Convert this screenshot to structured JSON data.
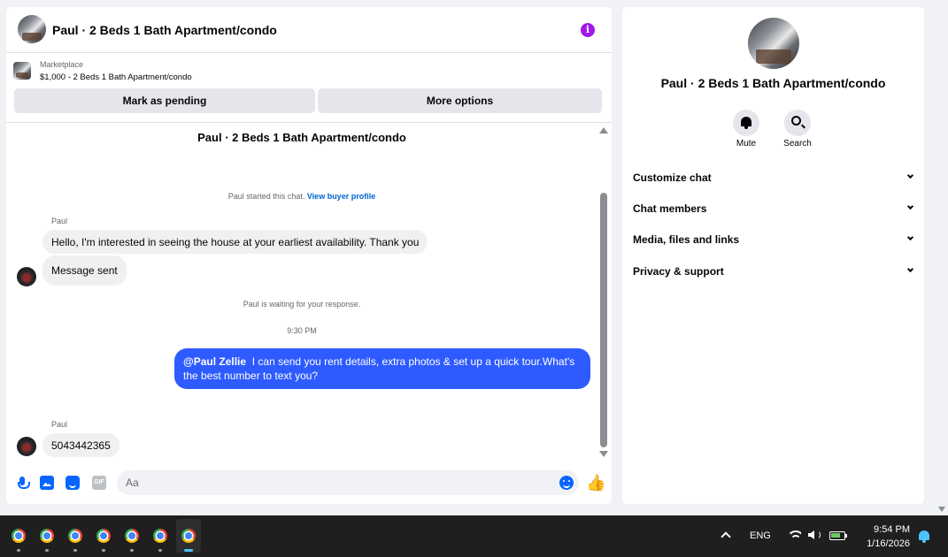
{
  "chat": {
    "header_title": "Paul · 2 Beds 1 Bath Apartment/condo",
    "info_glyph": "i",
    "marketplace_label": "Marketplace",
    "listing": "$1,000 - 2 Beds 1 Bath Apartment/condo",
    "mark_pending_label": "Mark as pending",
    "more_options_label": "More options",
    "thread_title": "Paul · 2 Beds 1 Bath Apartment/condo",
    "started_text": "Paul started this chat.",
    "view_profile_link": "View buyer profile",
    "waiting_text": "Paul is waiting for your response.",
    "timestamp": "9:30 PM",
    "messages": [
      {
        "sender": "Paul",
        "text": "Hello, I'm interested in seeing the house at your earliest availability. Thank you"
      },
      {
        "text": "Message sent"
      },
      {
        "mention": "@Paul Zellie",
        "text": "I can send you rent details, extra photos & set up a quick tour.What's the best number to text you?"
      },
      {
        "sender": "Paul",
        "text": "5043442365"
      }
    ],
    "composer_placeholder": "Aa",
    "gif_label": "GIF",
    "like_glyph": "👍"
  },
  "side": {
    "title": "Paul · 2 Beds 1 Bath Apartment/condo",
    "mute_label": "Mute",
    "search_label": "Search",
    "sections": [
      "Customize chat",
      "Chat members",
      "Media, files and links",
      "Privacy & support"
    ]
  },
  "taskbar": {
    "apps": [
      "chrome-icon",
      "chrome-icon",
      "chrome-icon",
      "chrome-icon",
      "chrome-icon",
      "chrome-icon",
      "chrome-icon"
    ],
    "language": "ENG",
    "time": "9:54 PM",
    "date": "1/16/2026"
  },
  "colors": {
    "outgoing_bubble": "#2e5bff",
    "accent": "#0866ff",
    "info_button": "#a01ae8",
    "link": "#0064d1"
  }
}
